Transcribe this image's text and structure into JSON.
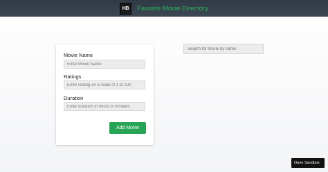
{
  "header": {
    "logo_text": "HB",
    "title": "Favorite Movie Directory"
  },
  "form": {
    "movie_name_label": "Movie Name",
    "movie_name_placeholder": "Enter Movie Name",
    "movie_name_value": "",
    "ratings_label": "Ratings",
    "ratings_placeholder": "Enter Rating on a scale of 1 to 100",
    "ratings_value": "",
    "duration_label": "Duration",
    "duration_placeholder": "Enter duration in hours or minutes",
    "duration_value": "",
    "add_button_label": "Add Movie"
  },
  "search": {
    "placeholder": "Search for movie by name",
    "value": ""
  },
  "sandbox_button_label": "Open Sandbox",
  "colors": {
    "accent": "#27a455",
    "header_bg": "#3c4753",
    "title_text": "#2ab35d"
  }
}
